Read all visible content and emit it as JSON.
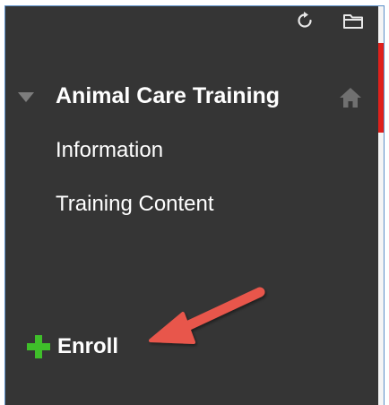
{
  "toolbar": {
    "refresh_icon": "refresh-icon",
    "folder_icon": "folder-icon"
  },
  "course": {
    "title": "Animal Care Training",
    "caret_icon": "caret-down-icon",
    "home_icon": "home-icon"
  },
  "menu": {
    "items": [
      {
        "label": "Information"
      },
      {
        "label": "Training Content"
      }
    ]
  },
  "enroll": {
    "label": "Enroll",
    "icon": "plus-icon"
  },
  "colors": {
    "panel_bg": "#353535",
    "accent_red": "#e0201b",
    "enroll_plus": "#3fbf2a",
    "arrow": "#e8574c"
  }
}
